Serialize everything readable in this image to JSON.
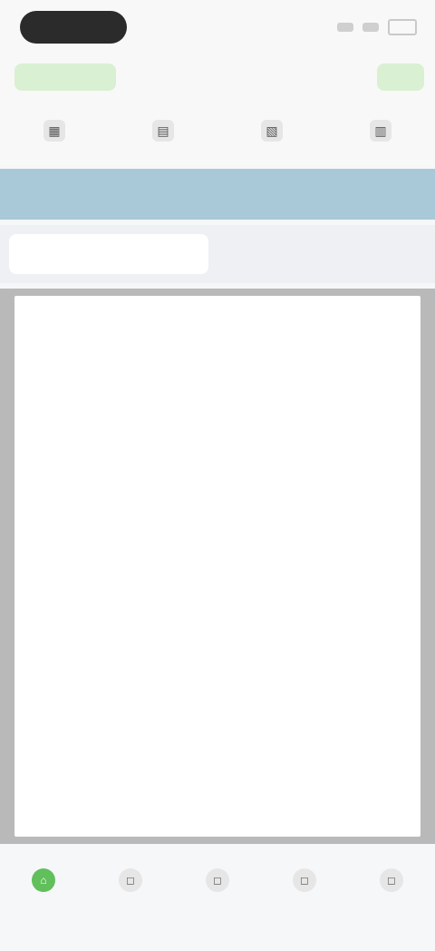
{
  "colors": {
    "accent_green": "#61bf5c",
    "banner_blue": "#a9c8d8",
    "frame_gray": "#b9b9b9",
    "pill_dark": "#2b2b2b"
  },
  "status_bar": {
    "pill_text": "",
    "icons": [
      "signal-icon",
      "wifi-icon",
      "battery-icon"
    ]
  },
  "nav": {
    "left_label": "",
    "title": "",
    "right_label": ""
  },
  "toolbar": {
    "items": [
      {
        "icon": "tool-icon",
        "label": ""
      },
      {
        "icon": "tool-icon",
        "label": ""
      },
      {
        "icon": "tool-icon",
        "label": ""
      },
      {
        "icon": "tool-icon",
        "label": ""
      }
    ]
  },
  "banner": {
    "text": ""
  },
  "tabs": [
    {
      "label": "",
      "active": true
    },
    {
      "label": "",
      "active": false
    }
  ],
  "document": {
    "header": "",
    "note": ""
  },
  "tabbar": {
    "items": [
      {
        "icon": "home-icon",
        "label": "",
        "active": true
      },
      {
        "icon": "tab-icon",
        "label": "",
        "active": false
      },
      {
        "icon": "tab-icon",
        "label": "",
        "active": false
      },
      {
        "icon": "tab-icon",
        "label": "",
        "active": false
      },
      {
        "icon": "tab-icon",
        "label": "",
        "active": false
      }
    ]
  }
}
